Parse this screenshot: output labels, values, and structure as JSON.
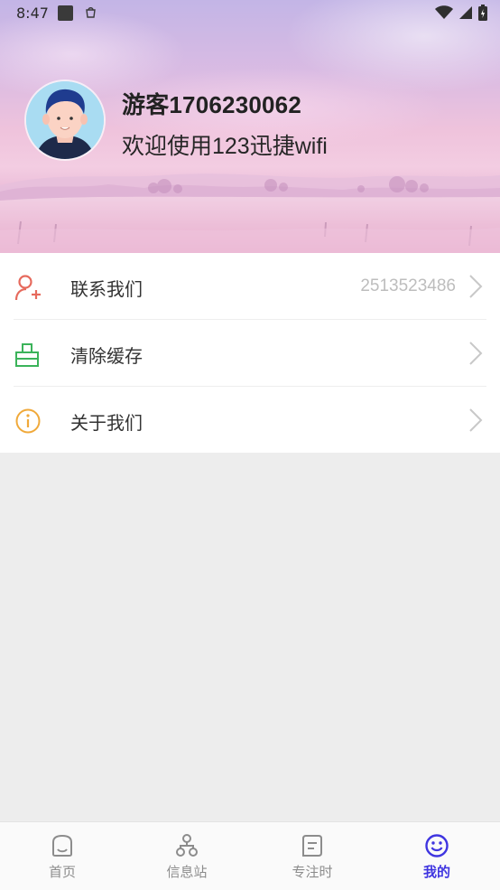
{
  "status_bar": {
    "time": "8:47"
  },
  "profile": {
    "username": "游客1706230062",
    "welcome": "欢迎使用123迅捷wifi"
  },
  "menu": {
    "items": [
      {
        "label": "联系我们",
        "value": "2513523486",
        "icon": "contact-person-add-icon",
        "color": "#e66a5d"
      },
      {
        "label": "清除缓存",
        "value": "",
        "icon": "clear-cache-icon",
        "color": "#3bb35a"
      },
      {
        "label": "关于我们",
        "value": "",
        "icon": "info-icon",
        "color": "#f0a93a"
      }
    ]
  },
  "tabbar": {
    "tabs": [
      {
        "label": "首页",
        "icon": "home-face-icon",
        "active": false
      },
      {
        "label": "信息站",
        "icon": "network-nodes-icon",
        "active": false
      },
      {
        "label": "专注时",
        "icon": "note-icon",
        "active": false
      },
      {
        "label": "我的",
        "icon": "smiley-icon",
        "active": true
      }
    ],
    "active_color": "#3f35e0",
    "inactive_color": "#8c8c8c"
  }
}
